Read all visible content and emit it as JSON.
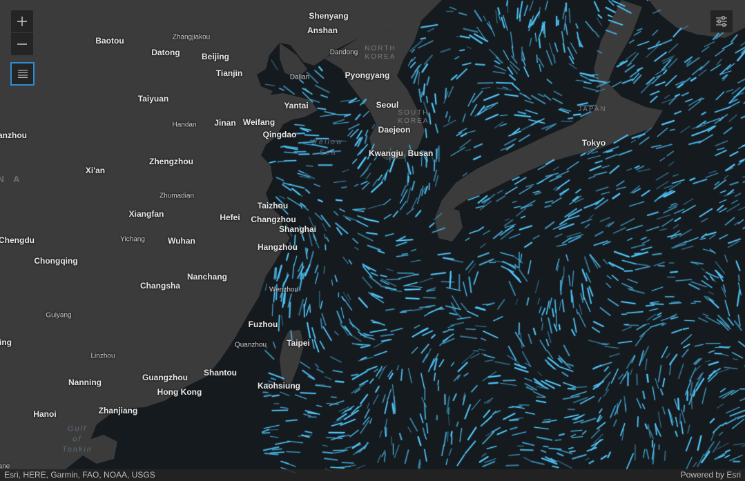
{
  "controls": {
    "zoom_in_icon": "plus-icon",
    "zoom_out_icon": "minus-icon",
    "layer_list_icon": "list-icon",
    "filter_icon": "sliders-icon"
  },
  "colors": {
    "land": "#3b3b3b",
    "ocean": "#151a1e",
    "flow": "#4fc3f7"
  },
  "labels": {
    "cities": [
      {
        "name": "Shenyang",
        "small": false
      },
      {
        "name": "Anshan",
        "small": false
      },
      {
        "name": "Zhangjiakou",
        "small": true
      },
      {
        "name": "Baotou",
        "small": false
      },
      {
        "name": "Datong",
        "small": false
      },
      {
        "name": "Beijing",
        "small": false
      },
      {
        "name": "Dandong",
        "small": true
      },
      {
        "name": "Tianjin",
        "small": false
      },
      {
        "name": "Dalian",
        "small": true
      },
      {
        "name": "Pyongyang",
        "small": false
      },
      {
        "name": "Taiyuan",
        "small": false
      },
      {
        "name": "Yantai",
        "small": false
      },
      {
        "name": "Seoul",
        "small": false
      },
      {
        "name": "Handan",
        "small": true
      },
      {
        "name": "Jinan",
        "small": false
      },
      {
        "name": "Weifang",
        "small": false
      },
      {
        "name": "Qingdao",
        "small": false
      },
      {
        "name": "Daejeon",
        "small": false
      },
      {
        "name": "anzhou",
        "small": false
      },
      {
        "name": "Tokyo",
        "small": false
      },
      {
        "name": "Kwangju",
        "small": false
      },
      {
        "name": "Busan",
        "small": false
      },
      {
        "name": "Zhengzhou",
        "small": false
      },
      {
        "name": "Xi'an",
        "small": false
      },
      {
        "name": "Zhumadian",
        "small": true
      },
      {
        "name": "Taizhou",
        "small": false
      },
      {
        "name": "Xiangfan",
        "small": false
      },
      {
        "name": "Hefei",
        "small": false
      },
      {
        "name": "Changzhou",
        "small": false
      },
      {
        "name": "Shanghai",
        "small": false
      },
      {
        "name": "Chengdu",
        "small": false
      },
      {
        "name": "Yichang",
        "small": true
      },
      {
        "name": "Wuhan",
        "small": false
      },
      {
        "name": "Hangzhou",
        "small": false
      },
      {
        "name": "Chongqing",
        "small": false
      },
      {
        "name": "Nanchang",
        "small": false
      },
      {
        "name": "Changsha",
        "small": false
      },
      {
        "name": "Wenzhou",
        "small": true
      },
      {
        "name": "Guiyang",
        "small": true
      },
      {
        "name": "Fuzhou",
        "small": false
      },
      {
        "name": "ing",
        "small": false
      },
      {
        "name": "Quanzhou",
        "small": true
      },
      {
        "name": "Taipei",
        "small": false
      },
      {
        "name": "Linzhou",
        "small": true
      },
      {
        "name": "Shantou",
        "small": false
      },
      {
        "name": "Nanning",
        "small": false
      },
      {
        "name": "Guangzhou",
        "small": false
      },
      {
        "name": "Kaohsiung",
        "small": false
      },
      {
        "name": "Hong Kong",
        "small": false
      },
      {
        "name": "Zhanjiang",
        "small": false
      },
      {
        "name": "Hanoi",
        "small": false
      },
      {
        "name": "ane",
        "small": true
      }
    ],
    "countries": [
      {
        "name": "NORTH\nKOREA",
        "big": false
      },
      {
        "name": "SOUTH\nKOREA",
        "big": false
      },
      {
        "name": "JAPAN",
        "big": false
      },
      {
        "name": "N A",
        "big": true
      }
    ],
    "water": [
      {
        "name": "Yellow\nSea"
      },
      {
        "name": "Gulf\nof\nTonkin"
      }
    ]
  },
  "attribution": {
    "sources": "Esri, HERE, Garmin, FAO, NOAA, USGS",
    "powered_by": "Powered by Esri"
  }
}
